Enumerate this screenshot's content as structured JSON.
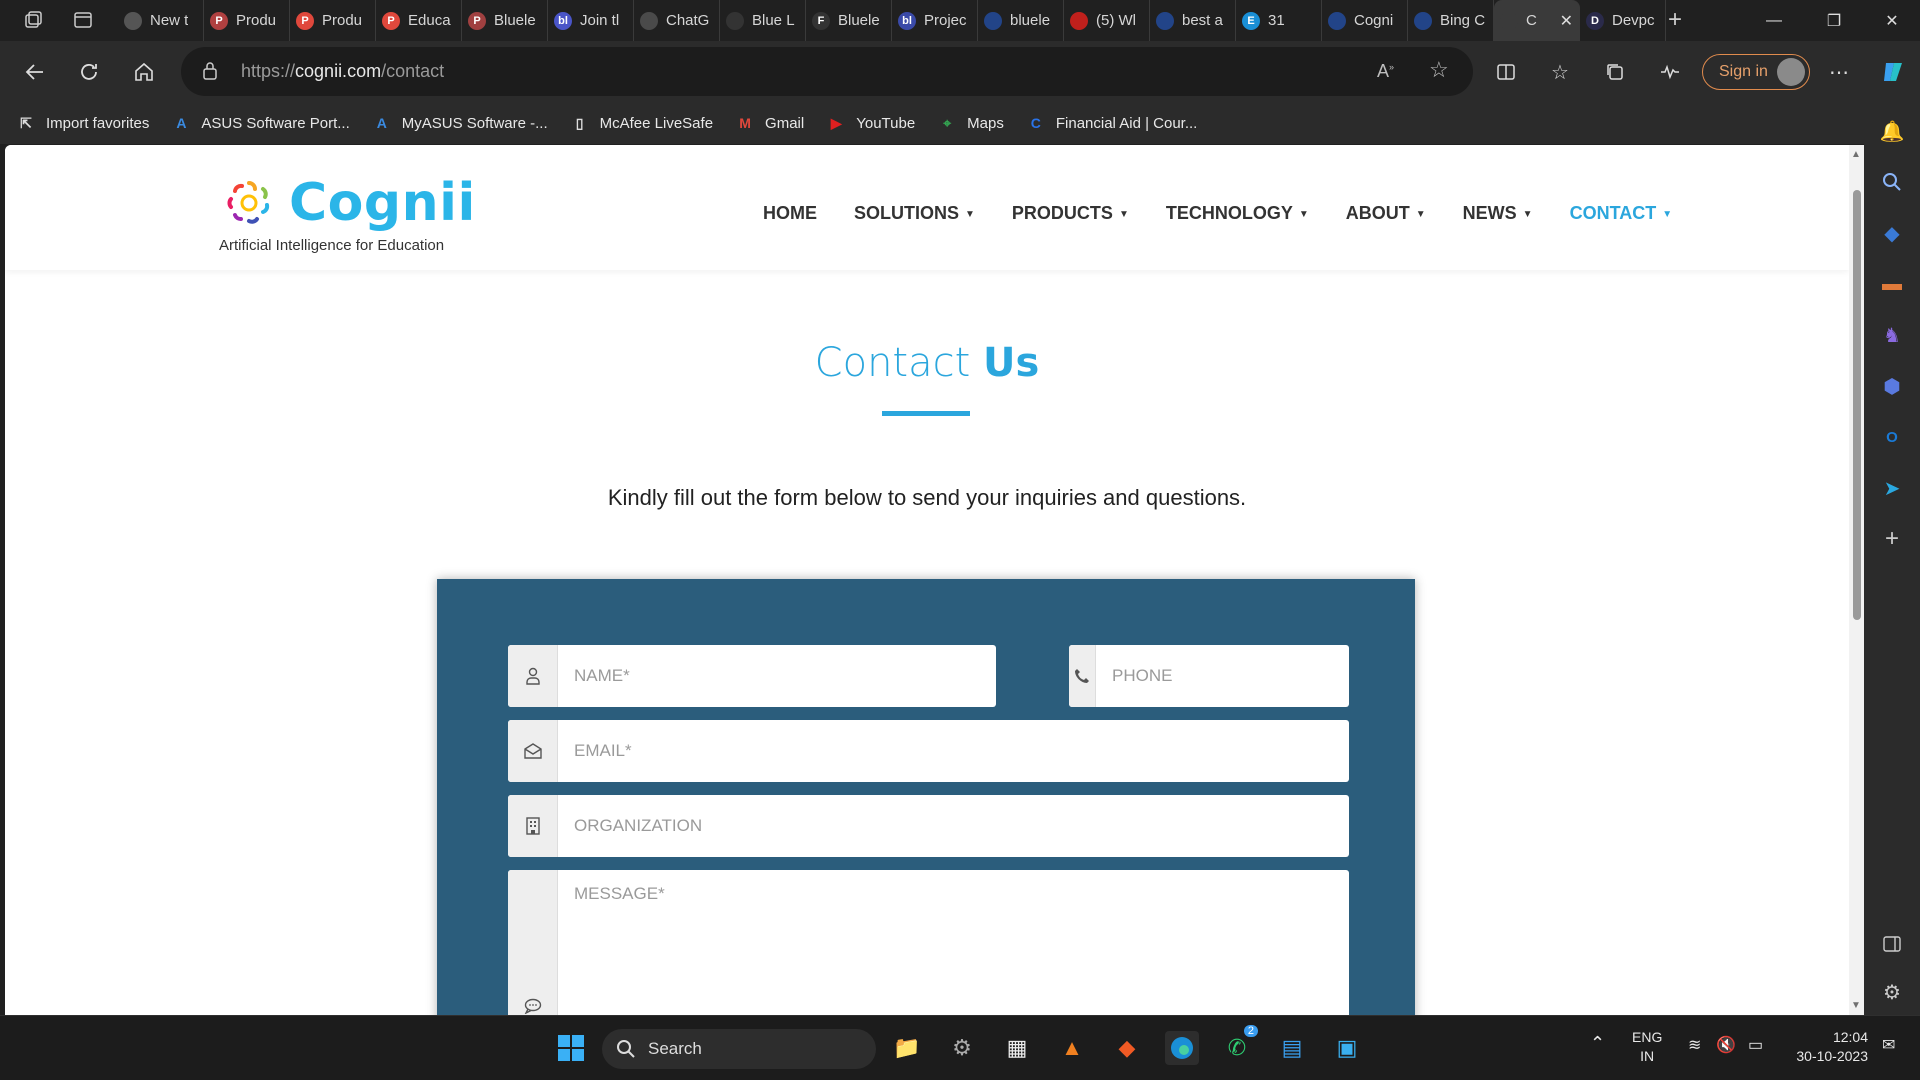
{
  "browser": {
    "tabs": [
      {
        "label": "New t",
        "color": "#555"
      },
      {
        "label": "Produ",
        "color": "#b04040",
        "glyph": "P"
      },
      {
        "label": "Produ",
        "color": "#e0483c",
        "glyph": "P"
      },
      {
        "label": "Educa",
        "color": "#e0483c",
        "glyph": "P"
      },
      {
        "label": "Bluele",
        "color": "#a04040",
        "glyph": "P"
      },
      {
        "label": "Join tl",
        "color": "#4a55c8",
        "glyph": "bl"
      },
      {
        "label": "ChatG",
        "color": "#4a4a4a"
      },
      {
        "label": "Blue L",
        "color": "#333"
      },
      {
        "label": "Bluele",
        "color": "#333",
        "glyph": "F"
      },
      {
        "label": "Projec",
        "color": "#3a4aa8",
        "glyph": "bl"
      },
      {
        "label": "bluele",
        "color": "#224488"
      },
      {
        "label": "(5) Wl",
        "color": "#c0201c"
      },
      {
        "label": "best a",
        "color": "#224488"
      },
      {
        "label": "31",
        "color": "#1a8fd6",
        "glyph": "E"
      },
      {
        "label": "Cogni",
        "color": "#224488"
      },
      {
        "label": "Bing C",
        "color": "#224488"
      },
      {
        "label": "C",
        "color": "#3a3a3a",
        "active": true
      },
      {
        "label": "Devpc",
        "color": "#2a2a4a",
        "glyph": "D"
      }
    ],
    "address": {
      "scheme": "https://",
      "host": "cognii.com",
      "path": "/contact"
    },
    "sign_in": "Sign in",
    "favorites": [
      {
        "label": "Import favorites",
        "icon": "import-icon"
      },
      {
        "label": "ASUS Software Port...",
        "icon": "asus-icon"
      },
      {
        "label": "MyASUS Software -...",
        "icon": "asus-icon"
      },
      {
        "label": "McAfee LiveSafe",
        "icon": "page-icon"
      },
      {
        "label": "Gmail",
        "icon": "gmail-icon"
      },
      {
        "label": "YouTube",
        "icon": "youtube-icon"
      },
      {
        "label": "Maps",
        "icon": "maps-icon"
      },
      {
        "label": "Financial Aid | Cour...",
        "icon": "coursera-icon"
      }
    ]
  },
  "site": {
    "logo_word": "Cognii",
    "logo_tagline": "Artificial Intelligence for Education",
    "nav": [
      {
        "label": "HOME",
        "caret": false
      },
      {
        "label": "SOLUTIONS",
        "caret": true
      },
      {
        "label": "PRODUCTS",
        "caret": true
      },
      {
        "label": "TECHNOLOGY",
        "caret": true
      },
      {
        "label": "ABOUT",
        "caret": true
      },
      {
        "label": "NEWS",
        "caret": true
      },
      {
        "label": "CONTACT",
        "caret": true,
        "active": true
      }
    ],
    "title_light": "Contact ",
    "title_bold": "Us",
    "intro": "Kindly fill out the form below to send your inquiries and questions.",
    "form": {
      "name_placeholder": "NAME*",
      "phone_placeholder": "PHONE",
      "email_placeholder": "EMAIL*",
      "organization_placeholder": "ORGANIZATION",
      "message_placeholder": "MESSAGE*"
    },
    "colors": {
      "accent": "#2ba6dd",
      "form_panel": "#2b5d7c"
    }
  },
  "taskbar": {
    "search_label": "Search",
    "language": "ENG",
    "region": "IN",
    "time": "12:04",
    "date": "30-10-2023",
    "whatsapp_badge": "2"
  }
}
